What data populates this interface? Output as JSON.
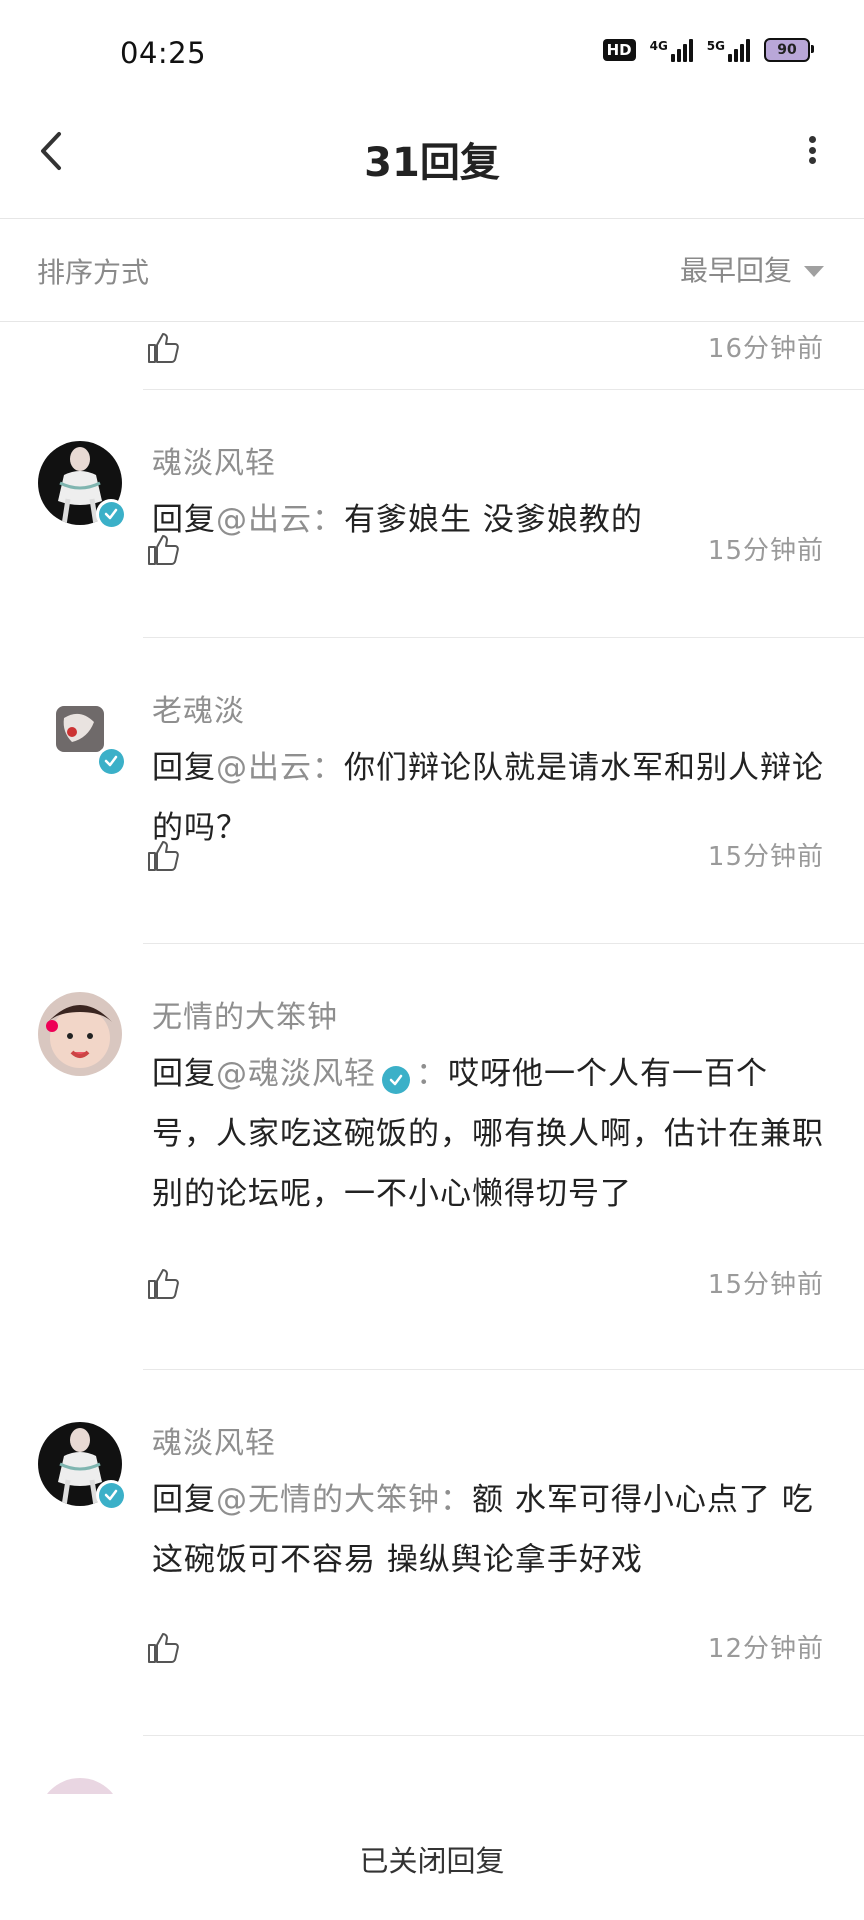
{
  "status_bar": {
    "time": "04:25",
    "hd_label": "HD",
    "net1_label": "4G",
    "net2_label": "5G",
    "battery_level": "90"
  },
  "header": {
    "title": "31回复"
  },
  "sort": {
    "label": "排序方式",
    "value": "最早回复"
  },
  "comments": [
    {
      "time": "16分钟前"
    },
    {
      "username": "魂淡风轻",
      "reply_prefix": "回复",
      "mention": "@出云",
      "colon": "：",
      "text": "有爹娘生 没爹娘教的",
      "time": "15分钟前"
    },
    {
      "username": "老魂淡",
      "reply_prefix": "回复",
      "mention": "@出云",
      "colon": "：",
      "text": "你们辩论队就是请水军和别人辩论的吗？",
      "time": "15分钟前"
    },
    {
      "username": "无情的大笨钟",
      "reply_prefix": "回复",
      "mention": "@魂淡风轻",
      "colon": "：",
      "text": "哎呀他一个人有一百个号，人家吃这碗饭的，哪有换人啊，估计在兼职别的论坛呢，一不小心懒得切号了",
      "time": "15分钟前"
    },
    {
      "username": "魂淡风轻",
      "reply_prefix": "回复",
      "mention": "@无情的大笨钟",
      "colon": "：",
      "text": "额 水军可得小心点了 吃这碗饭可不容易 操纵舆论拿手好戏",
      "time": "12分钟前"
    }
  ],
  "footer": {
    "text": "已关闭回复"
  },
  "colors": {
    "verified": "#3bb0c8",
    "muted_text": "#8f8f8f",
    "divider": "#e8e8e8"
  }
}
